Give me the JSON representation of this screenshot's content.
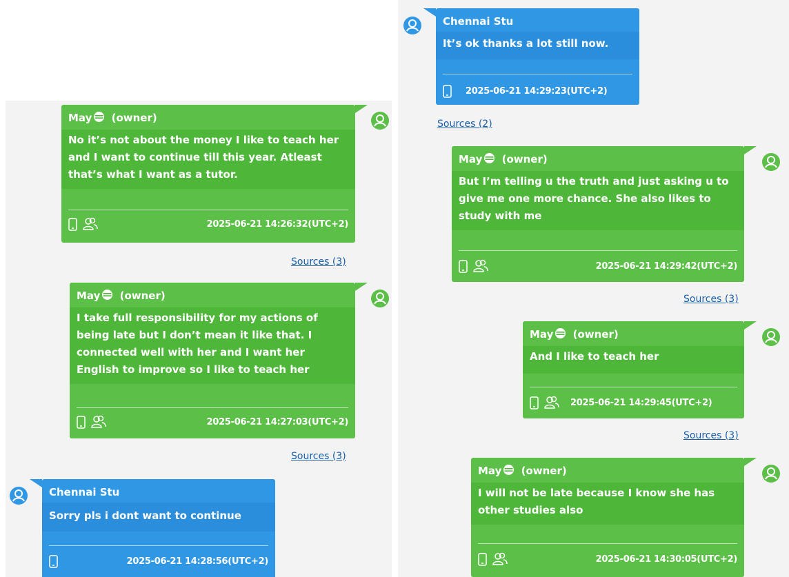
{
  "left_messages": [
    {
      "sender": "May",
      "role": "(owner)",
      "text": "No it’s not about the money I like to teach her and I want to continue till this year. Atleast that’s what I want as a tutor.",
      "timestamp": "2025-06-21 14:26:32(UTC+2)",
      "sources": "Sources (3)"
    },
    {
      "sender": "May",
      "role": "(owner)",
      "text": "I take full responsibility for my actions of being late but I don’t mean it like that. I connected well with her and I want her English to improve so I like to teach her",
      "timestamp": "2025-06-21 14:27:03(UTC+2)",
      "sources": "Sources (3)"
    },
    {
      "sender": "Chennai Stu",
      "text": "Sorry pls i dont want to continue",
      "timestamp": "2025-06-21 14:28:56(UTC+2)"
    }
  ],
  "right_messages": [
    {
      "sender": "Chennai Stu",
      "text": "It’s ok thanks a lot still now.",
      "timestamp": "2025-06-21 14:29:23(UTC+2)",
      "sources": "Sources (2)"
    },
    {
      "sender": "May",
      "role": "(owner)",
      "text": "But I’m telling u the truth and just asking u to give me one more chance. She also likes to study with me",
      "timestamp": "2025-06-21 14:29:42(UTC+2)",
      "sources": "Sources (3)"
    },
    {
      "sender": "May",
      "role": "(owner)",
      "text": "And I like to teach her",
      "timestamp": "2025-06-21 14:29:45(UTC+2)",
      "sources": "Sources (3)"
    },
    {
      "sender": "May",
      "role": "(owner)",
      "text": "I will not be late because I know she has other studies also",
      "timestamp": "2025-06-21 14:30:05(UTC+2)"
    }
  ],
  "icons": {
    "avatar": "person-avatar-icon",
    "device": "phone-icon",
    "participants": "group-icon",
    "sender_emoji": "face-emoji-icon"
  },
  "colors": {
    "owner_bubble": "#5cbf47",
    "contact_bubble": "#2f97e4",
    "link": "#1a5fa8",
    "panel_bg": "#f3f3f3"
  }
}
